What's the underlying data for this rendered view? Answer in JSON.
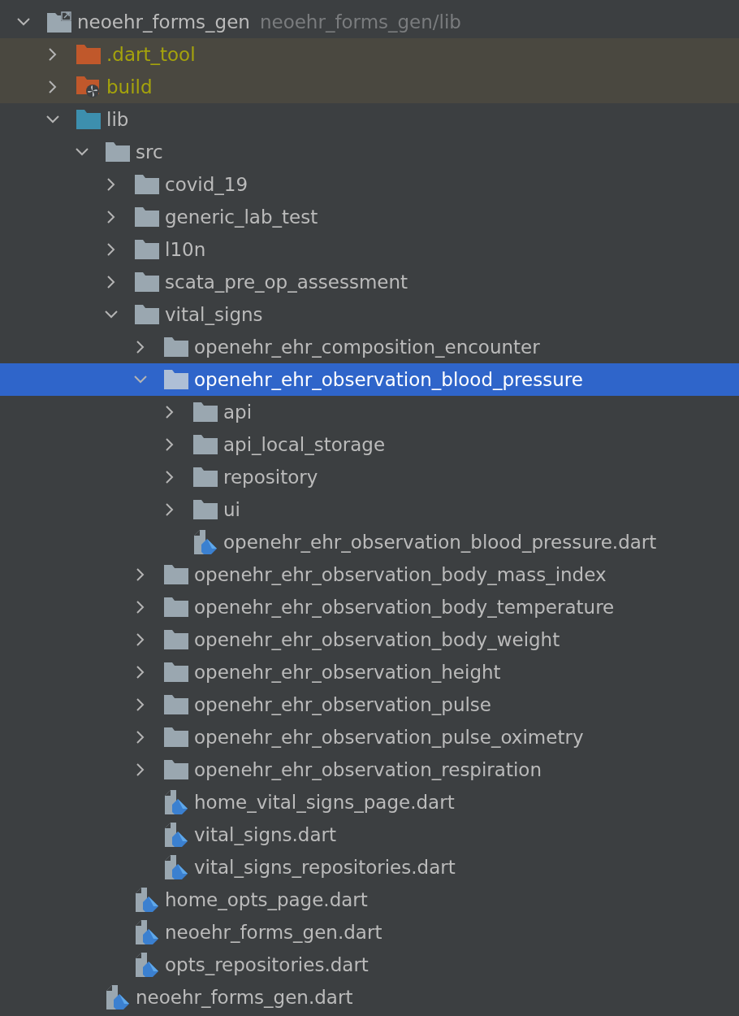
{
  "tree": [
    {
      "name": "neoehr_forms_gen",
      "kind": "module",
      "path": "neoehr_forms_gen/lib",
      "expanded": true,
      "selected": false,
      "children": [
        {
          "name": ".dart_tool",
          "kind": "excluded",
          "expanded": false,
          "selected": false
        },
        {
          "name": "build",
          "kind": "generated",
          "expanded": false,
          "selected": false
        },
        {
          "name": "lib",
          "kind": "source",
          "expanded": true,
          "selected": false,
          "children": [
            {
              "name": "src",
              "kind": "folder",
              "expanded": true,
              "selected": false,
              "children": [
                {
                  "name": "covid_19",
                  "kind": "folder",
                  "expanded": false,
                  "selected": false
                },
                {
                  "name": "generic_lab_test",
                  "kind": "folder",
                  "expanded": false,
                  "selected": false
                },
                {
                  "name": "l10n",
                  "kind": "folder",
                  "expanded": false,
                  "selected": false
                },
                {
                  "name": "scata_pre_op_assessment",
                  "kind": "folder",
                  "expanded": false,
                  "selected": false
                },
                {
                  "name": "vital_signs",
                  "kind": "folder",
                  "expanded": true,
                  "selected": false,
                  "children": [
                    {
                      "name": "openehr_ehr_composition_encounter",
                      "kind": "folder",
                      "expanded": false,
                      "selected": false
                    },
                    {
                      "name": "openehr_ehr_observation_blood_pressure",
                      "kind": "folder",
                      "expanded": true,
                      "selected": true,
                      "children": [
                        {
                          "name": "api",
                          "kind": "folder",
                          "expanded": false,
                          "selected": false
                        },
                        {
                          "name": "api_local_storage",
                          "kind": "folder",
                          "expanded": false,
                          "selected": false
                        },
                        {
                          "name": "repository",
                          "kind": "folder",
                          "expanded": false,
                          "selected": false
                        },
                        {
                          "name": "ui",
                          "kind": "folder",
                          "expanded": false,
                          "selected": false
                        },
                        {
                          "name": "openehr_ehr_observation_blood_pressure.dart",
                          "kind": "dart",
                          "selected": false
                        }
                      ]
                    },
                    {
                      "name": "openehr_ehr_observation_body_mass_index",
                      "kind": "folder",
                      "expanded": false,
                      "selected": false
                    },
                    {
                      "name": "openehr_ehr_observation_body_temperature",
                      "kind": "folder",
                      "expanded": false,
                      "selected": false
                    },
                    {
                      "name": "openehr_ehr_observation_body_weight",
                      "kind": "folder",
                      "expanded": false,
                      "selected": false
                    },
                    {
                      "name": "openehr_ehr_observation_height",
                      "kind": "folder",
                      "expanded": false,
                      "selected": false
                    },
                    {
                      "name": "openehr_ehr_observation_pulse",
                      "kind": "folder",
                      "expanded": false,
                      "selected": false
                    },
                    {
                      "name": "openehr_ehr_observation_pulse_oximetry",
                      "kind": "folder",
                      "expanded": false,
                      "selected": false
                    },
                    {
                      "name": "openehr_ehr_observation_respiration",
                      "kind": "folder",
                      "expanded": false,
                      "selected": false
                    },
                    {
                      "name": "home_vital_signs_page.dart",
                      "kind": "dart",
                      "selected": false
                    },
                    {
                      "name": "vital_signs.dart",
                      "kind": "dart",
                      "selected": false
                    },
                    {
                      "name": "vital_signs_repositories.dart",
                      "kind": "dart",
                      "selected": false
                    }
                  ]
                },
                {
                  "name": "home_opts_page.dart",
                  "kind": "dart",
                  "selected": false
                },
                {
                  "name": "neoehr_forms_gen.dart",
                  "kind": "dart",
                  "selected": false
                },
                {
                  "name": "opts_repositories.dart",
                  "kind": "dart",
                  "selected": false
                }
              ]
            },
            {
              "name": "neoehr_forms_gen.dart",
              "kind": "dart",
              "selected": false
            }
          ]
        }
      ]
    }
  ]
}
